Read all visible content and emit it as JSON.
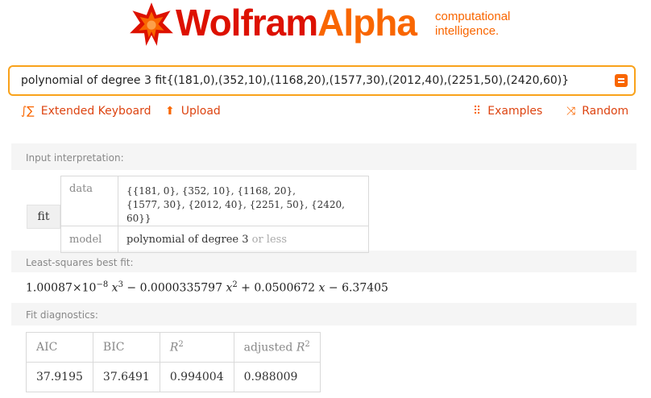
{
  "brand": {
    "word1": "Wolfram",
    "word2": "Alpha",
    "tagline1": "computational",
    "tagline2": "intelligence."
  },
  "search": {
    "query": "polynomial of degree 3 fit{(181,0),(352,10),(1168,20),(1577,30),(2012,40),(2251,50),(2420,60)}"
  },
  "toolbar": {
    "extended_keyboard": "Extended Keyboard",
    "upload": "Upload",
    "examples": "Examples",
    "random": "Random"
  },
  "interpretation": {
    "label": "Input interpretation:",
    "fit": "fit",
    "data_key": "data",
    "data_line1": "{{181, 0}, {352, 10}, {1168, 20},",
    "data_line2": "{1577, 30}, {2012, 40}, {2251, 50}, {2420, 60}}",
    "model_key": "model",
    "model_value": "polynomial of degree 3",
    "model_suffix": " or less"
  },
  "bestfit": {
    "label": "Least-squares best fit:",
    "c3": "1.00087",
    "c3_exp": "−8",
    "mid1": " − 0.0000335797 ",
    "mid2": " + 0.0500672 ",
    "tail": " − 6.37405"
  },
  "diagnostics": {
    "label": "Fit diagnostics:",
    "headers": [
      "AIC",
      "BIC",
      "R",
      "adjusted R"
    ],
    "values": [
      "37.9195",
      "37.6491",
      "0.994004",
      "0.988009"
    ]
  },
  "colors": {
    "brand_red": "#dd1100",
    "brand_orange": "#f96600",
    "search_border": "#f9a21a"
  }
}
